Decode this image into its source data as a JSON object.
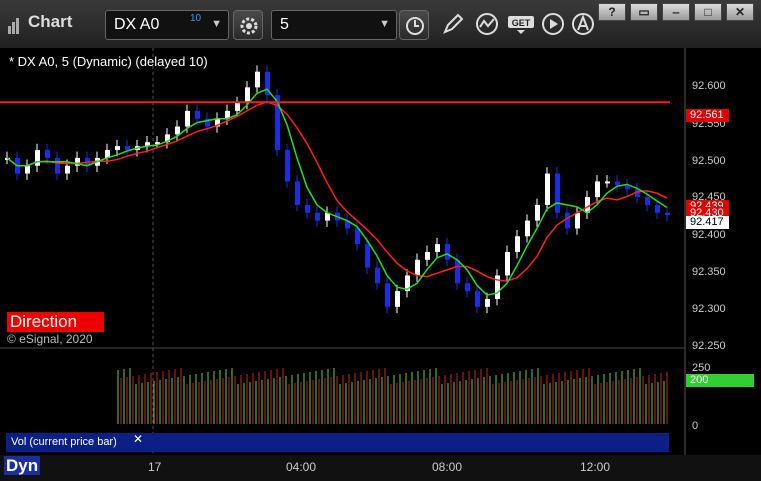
{
  "app": {
    "title": "Chart"
  },
  "toolbar": {
    "symbol": "DX A0",
    "symbol_superscript": "10",
    "interval": "5"
  },
  "chart": {
    "caption": "* DX A0, 5 (Dynamic) (delayed 10)",
    "direction_label": "Direction",
    "copyright": "© eSignal, 2020",
    "price_ticks": [
      "92.600",
      "92.550",
      "92.500",
      "92.450",
      "92.400",
      "92.350",
      "92.300",
      "92.250"
    ],
    "badges": [
      {
        "text": "92.561",
        "bg": "#e00000",
        "fg": "#ffffff"
      },
      {
        "text": "92.439",
        "bg": "#e00000",
        "fg": "#ffffff"
      },
      {
        "text": "92.430",
        "bg": "#e00000",
        "fg": "#ffffff"
      },
      {
        "text": "92.417",
        "bg": "#ffffff",
        "fg": "#000000"
      }
    ]
  },
  "volume": {
    "label": "Vol (current price bar)",
    "ticks": [
      "250",
      "0"
    ],
    "badge": {
      "text": "200",
      "bg": "#33cc33",
      "fg": "#ffffff"
    }
  },
  "time_axis": {
    "dyn_label": "Dyn",
    "labels": [
      "17",
      "04:00",
      "08:00",
      "12:00"
    ]
  },
  "colors": {
    "up_candle": "#ffffff",
    "down_candle": "#1a2ee0",
    "red_line": "#ff2020",
    "green_line": "#22dd22"
  },
  "chart_data": {
    "type": "candlestick",
    "title": "",
    "ylim": [
      92.25,
      92.62
    ],
    "horizontal_lines": [
      92.561
    ],
    "series": [
      {
        "name": "",
        "points": [
          [
            0,
            92.49
          ],
          [
            10,
            92.47
          ],
          [
            20,
            92.48
          ],
          [
            30,
            92.5
          ],
          [
            40,
            92.49
          ],
          [
            50,
            92.47
          ],
          [
            60,
            92.48
          ],
          [
            70,
            92.49
          ],
          [
            80,
            92.48
          ],
          [
            90,
            92.49
          ],
          [
            100,
            92.5
          ],
          [
            110,
            92.505
          ],
          [
            120,
            92.5
          ],
          [
            130,
            92.505
          ],
          [
            140,
            92.51
          ],
          [
            150,
            92.51
          ],
          [
            160,
            92.52
          ],
          [
            170,
            92.53
          ],
          [
            180,
            92.55
          ],
          [
            190,
            92.54
          ],
          [
            200,
            92.53
          ],
          [
            210,
            92.54
          ],
          [
            220,
            92.55
          ],
          [
            230,
            92.56
          ],
          [
            240,
            92.58
          ],
          [
            250,
            92.6
          ],
          [
            260,
            92.57
          ],
          [
            270,
            92.5
          ],
          [
            280,
            92.46
          ],
          [
            290,
            92.43
          ],
          [
            300,
            92.42
          ],
          [
            310,
            92.41
          ],
          [
            320,
            92.42
          ],
          [
            330,
            92.41
          ],
          [
            340,
            92.4
          ],
          [
            350,
            92.38
          ],
          [
            360,
            92.35
          ],
          [
            370,
            92.33
          ],
          [
            380,
            92.3
          ],
          [
            390,
            92.32
          ],
          [
            400,
            92.34
          ],
          [
            410,
            92.36
          ],
          [
            420,
            92.37
          ],
          [
            430,
            92.38
          ],
          [
            440,
            92.36
          ],
          [
            450,
            92.33
          ],
          [
            460,
            92.32
          ],
          [
            470,
            92.3
          ],
          [
            480,
            92.31
          ],
          [
            490,
            92.34
          ],
          [
            500,
            92.37
          ],
          [
            510,
            92.39
          ],
          [
            520,
            92.41
          ],
          [
            530,
            92.43
          ],
          [
            540,
            92.47
          ],
          [
            550,
            92.42
          ],
          [
            560,
            92.4
          ],
          [
            570,
            92.42
          ],
          [
            580,
            92.44
          ],
          [
            590,
            92.46
          ],
          [
            600,
            92.46
          ],
          [
            610,
            92.455
          ],
          [
            620,
            92.45
          ],
          [
            630,
            92.44
          ],
          [
            640,
            92.43
          ],
          [
            650,
            92.42
          ],
          [
            660,
            92.417
          ]
        ]
      }
    ]
  }
}
